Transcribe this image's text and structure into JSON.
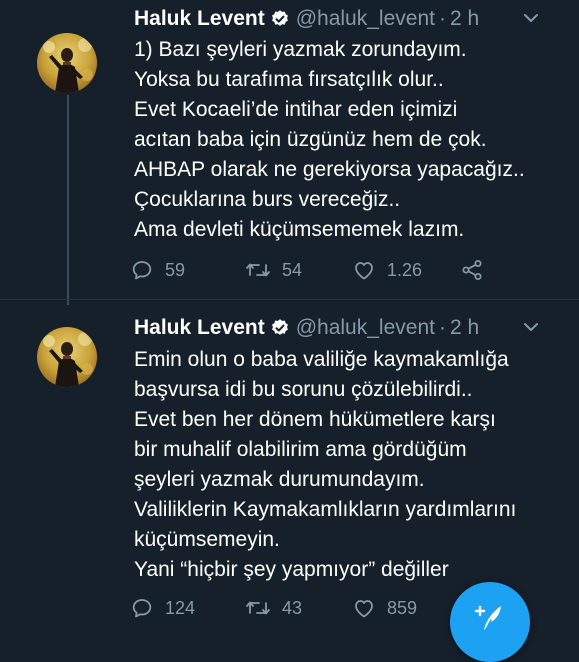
{
  "theme": {
    "background": "#15202b",
    "text": "#ffffff",
    "secondary_text": "#8899a6",
    "accent": "#1da1f2",
    "divider": "#263340"
  },
  "tweets": [
    {
      "author": {
        "name": "Haluk Levent",
        "handle": "@haluk_levent",
        "verified": true,
        "verified_icon": "verified-badge-icon"
      },
      "separator": "·",
      "time": "2 h",
      "lines": [
        "1) Bazı şeyleri yazmak zorundayım.",
        "Yoksa bu tarafıma fırsatçılık olur..",
        "Evet Kocaeli’de intihar eden içimizi",
        "acıtan baba için üzgünüz hem de çok.",
        "AHBAP olarak ne gerekiyorsa yapacağız..",
        "Çocuklarına burs vereceğiz..",
        "Ama devleti küçümsememek lazım."
      ],
      "actions": {
        "replies": "59",
        "retweets": "54",
        "likes": "1.26"
      }
    },
    {
      "author": {
        "name": "Haluk Levent",
        "handle": "@haluk_levent",
        "verified": true,
        "verified_icon": "verified-badge-icon"
      },
      "separator": "·",
      "time": "2 h",
      "lines": [
        "Emin olun o baba valiliğe kaymakamlığa",
        "başvursa idi bu sorunu çözülebilirdi..",
        "Evet ben her dönem hükümetlere karşı",
        "bir muhalif olabilirim ama gördüğüm",
        "şeyleri yazmak durumundayım.",
        "Valiliklerin Kaymakamlıkların yardımlarını",
        "küçümsemeyin.",
        "Yani “hiçbir şey yapmıyor” değiller"
      ],
      "actions": {
        "replies": "124",
        "retweets": "43",
        "likes": "859"
      }
    }
  ],
  "icons": {
    "reply": "reply-icon",
    "retweet": "retweet-icon",
    "like": "heart-icon",
    "share": "share-icon",
    "menu": "chevron-down-icon",
    "compose": "compose-tweet-icon"
  }
}
